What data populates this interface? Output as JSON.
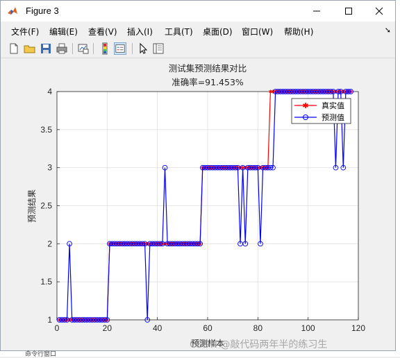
{
  "window": {
    "title": "Figure 3"
  },
  "menu": [
    {
      "label": "文件(F)"
    },
    {
      "label": "编辑(E)"
    },
    {
      "label": "查看(V)"
    },
    {
      "label": "插入(I)"
    },
    {
      "label": "工具(T)"
    },
    {
      "label": "桌面(D)"
    },
    {
      "label": "窗口(W)"
    },
    {
      "label": "帮助(H)"
    }
  ],
  "toolbar_icons": [
    "new-figure-icon",
    "open-file-icon",
    "save-icon",
    "print-icon",
    "link-plot-icon",
    "colorbar-icon",
    "legend-icon",
    "pointer-icon",
    "property-inspector-icon"
  ],
  "watermark": "CSDN @敲代码两年半的练习生",
  "bottom_text": "命令行窗口",
  "chart_data": {
    "type": "line",
    "title": "测试集预测结果对比",
    "subtitle": "准确率=91.453%",
    "xlabel": "预测样本",
    "ylabel": "预测结果",
    "xlim": [
      0,
      120
    ],
    "ylim": [
      1,
      4
    ],
    "xticks": [
      "0",
      "20",
      "40",
      "60",
      "80",
      "100",
      "120"
    ],
    "yticks": [
      "1",
      "1.5",
      "2",
      "2.5",
      "3",
      "3.5",
      "4"
    ],
    "grid": true,
    "legend_position": "top-right",
    "colors": {
      "true": "#ff0000",
      "pred": "#0000ff"
    },
    "series": [
      {
        "name": "真实值",
        "marker": "asterisk",
        "values": [
          1,
          1,
          1,
          1,
          1,
          1,
          1,
          1,
          1,
          1,
          1,
          1,
          1,
          1,
          1,
          1,
          1,
          1,
          1,
          1,
          2,
          2,
          2,
          2,
          2,
          2,
          2,
          2,
          2,
          2,
          2,
          2,
          2,
          2,
          2,
          2,
          2,
          2,
          2,
          2,
          2,
          2,
          2,
          2,
          2,
          2,
          2,
          2,
          2,
          2,
          2,
          2,
          2,
          2,
          2,
          2,
          2,
          3,
          3,
          3,
          3,
          3,
          3,
          3,
          3,
          3,
          3,
          3,
          3,
          3,
          3,
          3,
          3,
          3,
          3,
          3,
          3,
          3,
          3,
          3,
          3,
          3,
          3,
          3,
          4,
          4,
          4,
          4,
          4,
          4,
          4,
          4,
          4,
          4,
          4,
          4,
          4,
          4,
          4,
          4,
          4,
          4,
          4,
          4,
          4,
          4,
          4,
          4,
          4,
          4,
          4,
          4,
          4,
          4,
          4,
          4,
          4
        ]
      },
      {
        "name": "预测值",
        "marker": "circle",
        "values": [
          1,
          1,
          1,
          1,
          2,
          1,
          1,
          1,
          1,
          1,
          1,
          1,
          1,
          1,
          1,
          1,
          1,
          1,
          1,
          1,
          2,
          2,
          2,
          2,
          2,
          2,
          2,
          2,
          2,
          2,
          2,
          2,
          2,
          2,
          2,
          1,
          2,
          2,
          2,
          2,
          2,
          2,
          3,
          2,
          2,
          2,
          2,
          2,
          2,
          2,
          2,
          2,
          2,
          2,
          2,
          2,
          2,
          3,
          3,
          3,
          3,
          3,
          3,
          3,
          3,
          3,
          3,
          3,
          3,
          3,
          3,
          3,
          2,
          3,
          2,
          3,
          3,
          3,
          3,
          3,
          2,
          3,
          3,
          3,
          3,
          3,
          4,
          4,
          4,
          4,
          4,
          4,
          4,
          4,
          4,
          4,
          4,
          4,
          4,
          4,
          4,
          4,
          4,
          4,
          4,
          4,
          4,
          4,
          4,
          4,
          3,
          4,
          4,
          3,
          4,
          4,
          4
        ]
      }
    ]
  }
}
